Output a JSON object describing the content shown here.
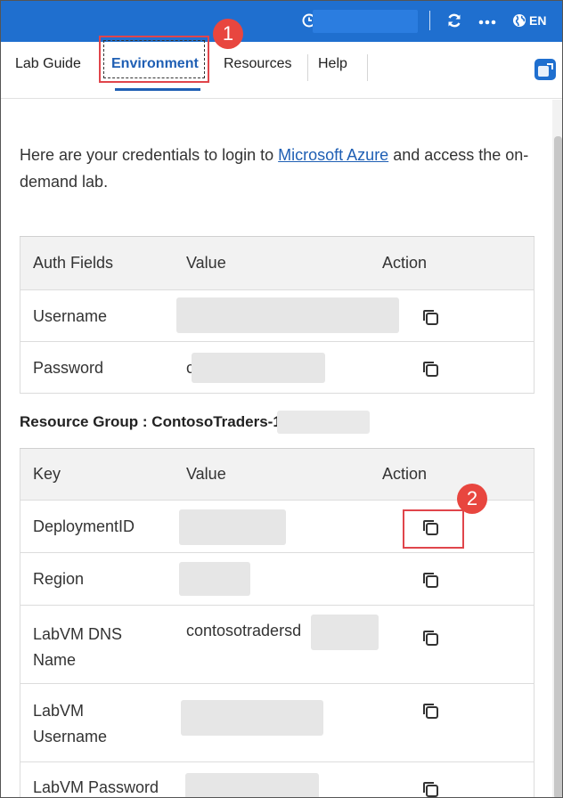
{
  "topbar": {
    "clock_icon": "clock-icon",
    "refresh_icon": "refresh-icon",
    "more_icon": "ellipsis-icon",
    "language_icon": "globe-icon",
    "language": "EN",
    "bar_color": "#1f6fcf"
  },
  "tabs": [
    {
      "label": "Lab Guide"
    },
    {
      "label": "Environment",
      "active": true
    },
    {
      "label": "Resources"
    },
    {
      "label": "Help"
    }
  ],
  "annotations": {
    "step1": "1",
    "step2": "2",
    "highlight_color": "#e0454b"
  },
  "intro": {
    "before_link": "Here are your credentials to login to ",
    "link": "Microsoft Azure",
    "after_link": " and access the on-demand lab."
  },
  "auth_table": {
    "headers": [
      "Auth Fields",
      "Value",
      "Action"
    ],
    "rows": [
      {
        "field": "Username",
        "value": ""
      },
      {
        "field": "Password",
        "value": "c"
      }
    ]
  },
  "resource_group": {
    "title": "Resource Group : ContosoTraders-1",
    "headers": [
      "Key",
      "Value",
      "Action"
    ],
    "rows": [
      {
        "key": "DeploymentID",
        "value": ""
      },
      {
        "key": "Region",
        "value": ""
      },
      {
        "key": "LabVM DNS Name",
        "value": "contosotradersd"
      },
      {
        "key": "LabVM Username",
        "value": ""
      },
      {
        "key": "LabVM Password",
        "value": ""
      }
    ]
  }
}
